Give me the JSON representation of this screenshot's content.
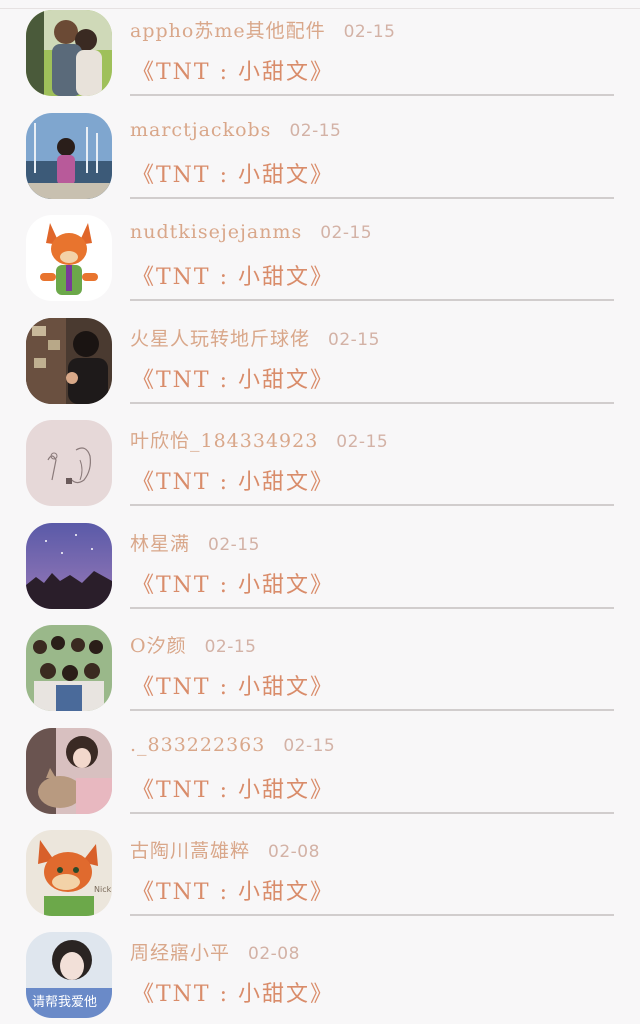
{
  "list": {
    "items": [
      {
        "name": "appho苏me其他配件",
        "date": "02-15",
        "title": "《TNT : 小甜文》",
        "avatar_icon": "couple-photo"
      },
      {
        "name": "marctjackobs",
        "date": "02-15",
        "title": "《TNT : 小甜文》",
        "avatar_icon": "harbor-photo"
      },
      {
        "name": "nudtkisejejanms",
        "date": "02-15",
        "title": "《TNT : 小甜文》",
        "avatar_icon": "fox-cartoon"
      },
      {
        "name": "火星人玩转地斤球佬",
        "date": "02-15",
        "title": "《TNT : 小甜文》",
        "avatar_icon": "person-photo"
      },
      {
        "name": "叶欣怡_184334923",
        "date": "02-15",
        "title": "《TNT : 小甜文》",
        "avatar_icon": "sketch-drawing"
      },
      {
        "name": "林星满",
        "date": "02-15",
        "title": "《TNT : 小甜文》",
        "avatar_icon": "night-sky"
      },
      {
        "name": "O汐颜",
        "date": "02-15",
        "title": "《TNT : 小甜文》",
        "avatar_icon": "group-photo"
      },
      {
        "name": "._833222363",
        "date": "02-15",
        "title": "《TNT : 小甜文》",
        "avatar_icon": "cat-photo"
      },
      {
        "name": "古陶川蒿雄粹",
        "date": "02-08",
        "title": "《TNT : 小甜文》",
        "avatar_icon": "fox-nick-wilde"
      },
      {
        "name": "周经寤小平",
        "date": "02-08",
        "title": "《TNT : 小甜文》",
        "avatar_icon": "girl-photo"
      }
    ]
  },
  "avatar_overlay_texts": {
    "item8": "Nick Wild",
    "item9": "请帮我爱他"
  },
  "colors": {
    "name": "#d9a78a",
    "date": "#d3b2a6",
    "title": "#d98c6a",
    "divider": "#d1cdcd",
    "background": "#f8f7f8"
  }
}
